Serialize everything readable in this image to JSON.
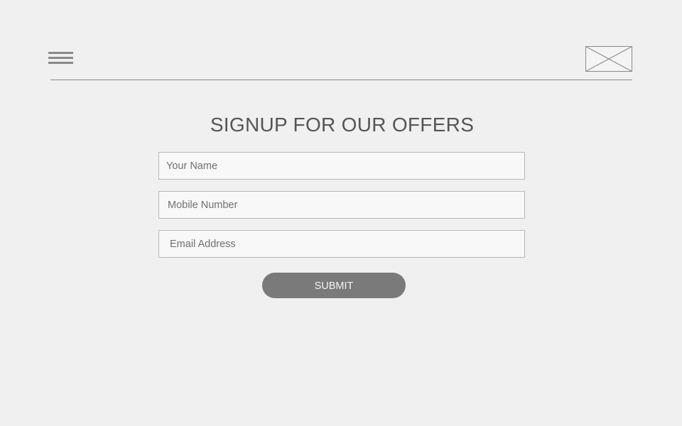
{
  "header": {
    "menu_icon": "hamburger-menu-icon",
    "logo": "image-placeholder"
  },
  "form": {
    "title": "SIGNUP FOR OUR OFFERS",
    "fields": [
      {
        "placeholder": "Your Name",
        "value": ""
      },
      {
        "placeholder": "Mobile Number",
        "value": ""
      },
      {
        "placeholder": "Email Address",
        "value": ""
      }
    ],
    "submit_label": "SUBMIT"
  },
  "colors": {
    "background": "#f0f0f0",
    "text": "#555555",
    "button": "#7a7a7a",
    "button_text": "#f4f4f4",
    "field_border": "#b8b8b8",
    "divider": "#8a8a8a"
  }
}
